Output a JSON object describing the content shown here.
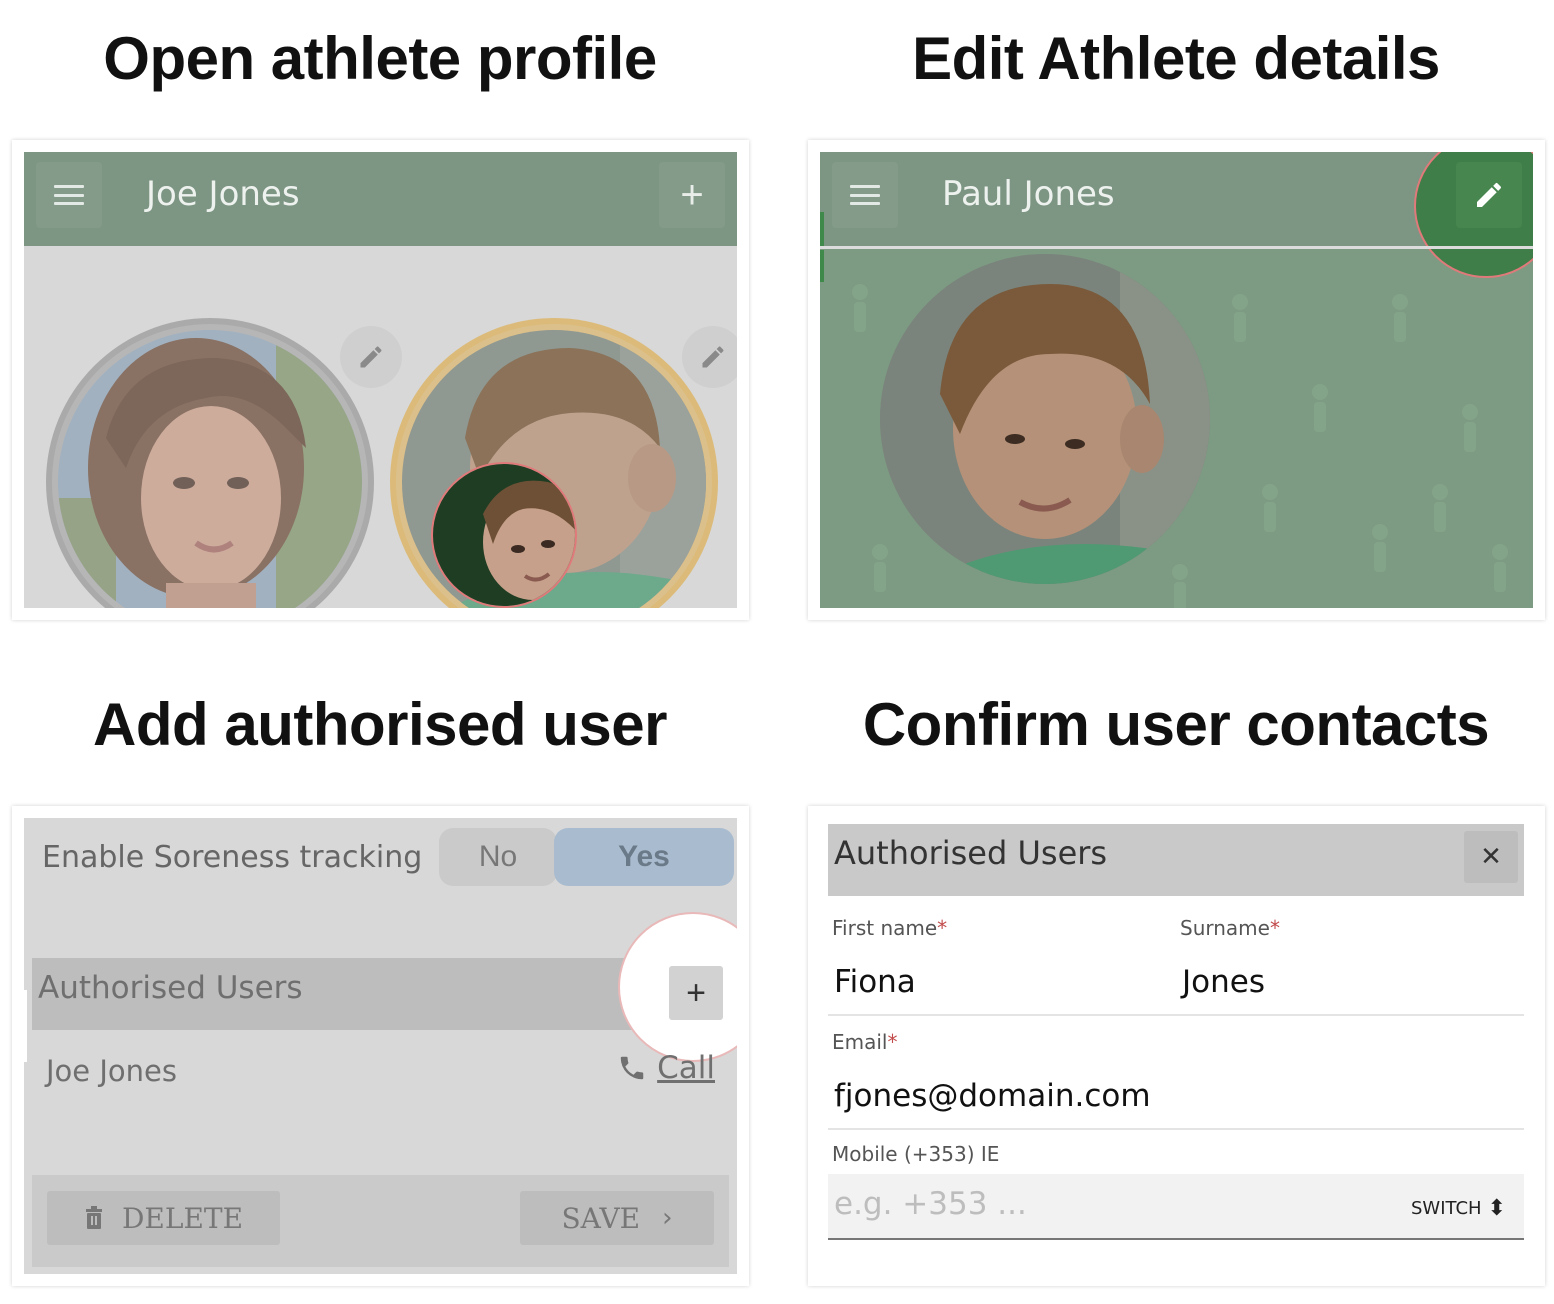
{
  "steps": [
    {
      "title": "Open athlete profile"
    },
    {
      "title": "Edit Athlete details"
    },
    {
      "title": "Add authorised user"
    },
    {
      "title": "Confirm user contacts"
    }
  ],
  "panel1": {
    "app_title": "Joe Jones",
    "menu_icon": "hamburger-icon",
    "add_icon": "plus-icon",
    "add_glyph": "+",
    "edit_icon": "pencil-icon"
  },
  "panel2": {
    "app_title": "Paul Jones",
    "menu_icon": "hamburger-icon",
    "edit_icon": "pencil-icon"
  },
  "panel3": {
    "soreness_label": "Enable Soreness tracking",
    "toggle_no": "No",
    "toggle_yes": "Yes",
    "section_title": "Authorised Users",
    "add_glyph": "+",
    "user_name": "Joe Jones",
    "call_label": "Call",
    "delete_label": "DELETE",
    "save_label": "SAVE",
    "save_chevron": "›"
  },
  "panel4": {
    "dialog_title": "Authorised Users",
    "close_glyph": "✕",
    "first_name_label": "First name",
    "first_name_value": "Fiona",
    "surname_label": "Surname",
    "surname_value": "Jones",
    "email_label": "Email",
    "email_value": "fjones@domain.com",
    "mobile_label": "Mobile (+353) IE",
    "mobile_placeholder": "e.g. +353 ...",
    "switch_label": "SWITCH",
    "switch_glyph": "⬍",
    "required_mark": "*"
  },
  "colors": {
    "appbar_green": "#7d9583",
    "highlight_red": "#e07a7a",
    "selected_blue": "#a9bccf",
    "gold_ring": "#dcbb7a",
    "required_red": "#c24a4a"
  }
}
